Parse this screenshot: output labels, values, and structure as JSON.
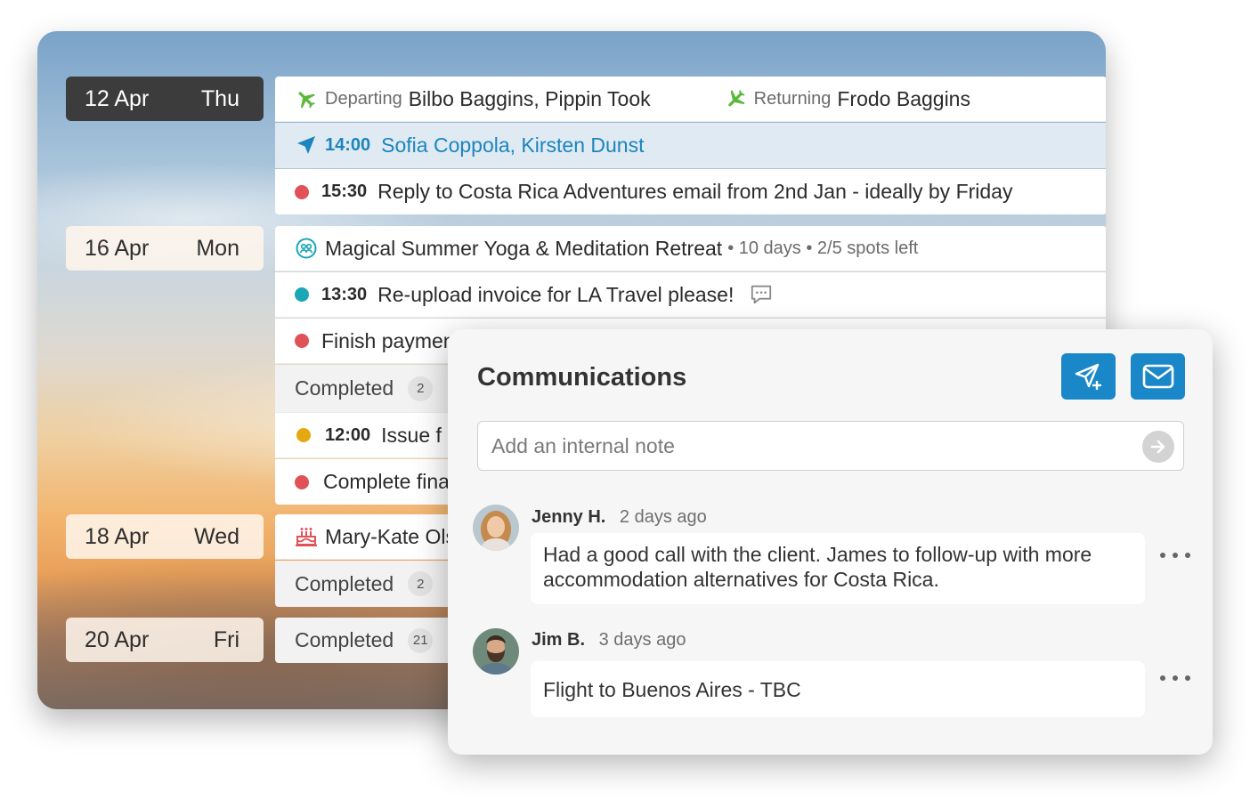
{
  "calendar": {
    "days": [
      {
        "date": "12 Apr",
        "weekday": "Thu"
      },
      {
        "date": "16 Apr",
        "weekday": "Mon"
      },
      {
        "date": "18 Apr",
        "weekday": "Wed"
      },
      {
        "date": "20 Apr",
        "weekday": "Fri"
      }
    ],
    "day1": {
      "departing_label": "Departing",
      "departing_names": "Bilbo Baggins, Pippin Took",
      "returning_label": "Returning",
      "returning_names": "Frodo Baggins",
      "flight_time": "14:00",
      "flight_names": "Sofia Coppola, Kirsten Dunst",
      "task_time": "15:30",
      "task_text": "Reply to Costa Rica Adventures email from 2nd Jan - ideally by Friday"
    },
    "day2": {
      "event_title": "Magical Summer Yoga & Meditation Retreat",
      "event_meta": "• 10 days • 2/5 spots left",
      "task1_time": "13:30",
      "task1_text": "Re-upload invoice for LA Travel please!",
      "task2_text": "Finish paymen",
      "completed_label": "Completed",
      "completed_count": "2",
      "task3_time": "12:00",
      "task3_text": "Issue f",
      "task4_text": "Complete fina"
    },
    "day3": {
      "birthday_text": "Mary-Kate Ols",
      "completed_label": "Completed",
      "completed_count": "2"
    },
    "day4": {
      "completed_label": "Completed",
      "completed_count": "21"
    }
  },
  "communications": {
    "title": "Communications",
    "note_placeholder": "Add an internal note",
    "comments": [
      {
        "author": "Jenny H.",
        "ago": "2 days ago",
        "text": "Had a good call with the client. James to follow-up with more accommodation alternatives for Costa Rica."
      },
      {
        "author": "Jim B.",
        "ago": "3 days ago",
        "text": "Flight to Buenos Aires - TBC"
      }
    ]
  },
  "colors": {
    "accent": "#1a88c8",
    "flight_green": "#5cb83c",
    "dot_red": "#e05257",
    "dot_teal": "#1aa7b5",
    "dot_yellow": "#e3a90e"
  }
}
